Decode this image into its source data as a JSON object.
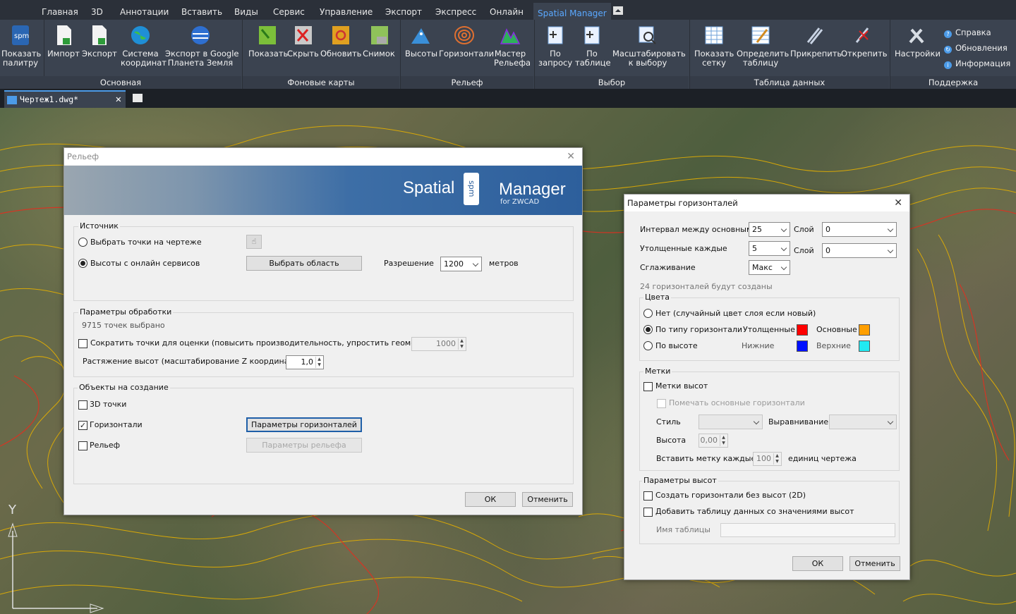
{
  "menu": {
    "tabs": [
      "Главная",
      "3D",
      "Аннотации",
      "Вставить",
      "Виды",
      "Сервис",
      "Управление",
      "Экспорт",
      "Экспресс",
      "Онлайн",
      "Spatial Manager"
    ],
    "active": "Spatial Manager"
  },
  "ribbon": {
    "groups": {
      "main": "Основная",
      "background": "Фоновые карты",
      "relief": "Рельеф",
      "select": "Выбор",
      "table": "Таблица данных",
      "support": "Поддержка"
    },
    "buttons": {
      "palette": [
        "Показать",
        "палитру"
      ],
      "import": "Импорт",
      "export": "Экспорт",
      "crs": [
        "Система",
        "координат"
      ],
      "google_earth": [
        "Экспорт в Google",
        "Планета Земля"
      ],
      "show": "Показать",
      "hide": "Скрыть",
      "refresh": "Обновить",
      "snapshot": "Снимок",
      "heights": "Высоты",
      "contours": "Горизонтали",
      "relief_wizard": [
        "Мастер",
        "Рельефа"
      ],
      "by_query": [
        "По",
        "запросу"
      ],
      "by_table": [
        "По",
        "таблице"
      ],
      "zoom_selection": [
        "Масштабировать",
        "к выбору"
      ],
      "show_grid": [
        "Показать",
        "сетку"
      ],
      "define_table": [
        "Определить",
        "таблицу"
      ],
      "attach": "Прикрепить",
      "detach": "Открепить",
      "settings": "Настройки"
    },
    "support_items": [
      "Справка",
      "Обновления",
      "Информация"
    ]
  },
  "doc_tab": "Чертеж1.dwg*",
  "relief_dialog": {
    "title": "Рельеф",
    "brand_left": "Spatial",
    "brand_right": "Manager",
    "brand_sub": "for ZWCAD",
    "brand_logo": "spm",
    "source": {
      "title": "Источник",
      "pick_points": "Выбрать точки на чертеже",
      "online_heights": "Высоты с онлайн сервисов",
      "select_area": "Выбрать область",
      "resolution_label": "Разрешение",
      "resolution_value": "1200",
      "resolution_unit": "метров"
    },
    "processing": {
      "title": "Параметры обработки",
      "points_selected": "9715 точек выбрано",
      "reduce_label": "Сократить точки для оценки (повысить производительность, упростить геометрию)",
      "reduce_value": "1000",
      "stretch_label": "Растяжение высот (масштабирование Z координат)",
      "stretch_value": "1,0"
    },
    "objects": {
      "title": "Объекты на создание",
      "points3d": "3D точки",
      "contours": "Горизонтали",
      "contours_params": "Параметры горизонталей",
      "relief": "Рельеф",
      "relief_params": "Параметры рельефа"
    },
    "ok": "ОК",
    "cancel": "Отменить"
  },
  "contour_dialog": {
    "title": "Параметры горизонталей",
    "interval_label": "Интервал между основными",
    "interval_value": "25",
    "layer_label": "Слой",
    "layer1_value": "0",
    "dense_label": "Утолщенные каждые",
    "dense_value": "5",
    "layer2_value": "0",
    "smoothing_label": "Сглаживание",
    "smoothing_value": "Макс",
    "will_create": "24 горизонталей будут созданы",
    "colors": {
      "title": "Цвета",
      "random": "Нет (случайный цвет слоя если новый)",
      "by_type": "По типу горизонтали",
      "by_height": "По высоте",
      "thick": "Утолщенные",
      "main": "Основные",
      "lower": "Нижние",
      "upper": "Верхние",
      "thick_color": "#ff0000",
      "main_color": "#ff9f00",
      "lower_color": "#0010ff",
      "upper_color": "#22eaf2"
    },
    "labels": {
      "title": "Метки",
      "height_labels": "Метки высот",
      "mark_main": "Помечать основные горизонтали",
      "style": "Стиль",
      "alignment": "Выравнивание",
      "height": "Высота",
      "height_value": "0,00",
      "insert_every": "Вставить метку каждые",
      "insert_value": "100",
      "units": "единиц чертежа"
    },
    "height_params": {
      "title": "Параметры высот",
      "no_heights": "Создать горизонтали без высот (2D)",
      "add_table": "Добавить таблицу данных со значениями высот",
      "table_name": "Имя таблицы"
    },
    "ok": "ОК",
    "cancel": "Отменить"
  },
  "ucs": {
    "y": "Y"
  }
}
